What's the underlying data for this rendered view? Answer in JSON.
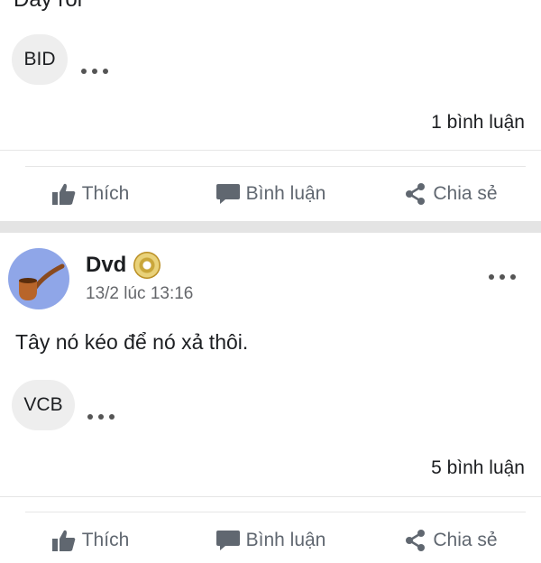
{
  "top_post": {
    "cut_text": "Đây rồi",
    "chip_label": "BID",
    "comment_count": "1 bình luận"
  },
  "actions": {
    "like": "Thích",
    "comment": "Bình luận",
    "share": "Chia sẻ"
  },
  "post": {
    "author": "Dvd",
    "timestamp": "13/2 lúc 13:16",
    "text": "Tây nó kéo để nó xả thôi.",
    "chip_label": "VCB",
    "comment_count": "5 bình luận"
  },
  "colors": {
    "accent_gray": "#606770",
    "avatar_bg": "#8fa6e8",
    "chip_bg": "#eeeeee"
  }
}
